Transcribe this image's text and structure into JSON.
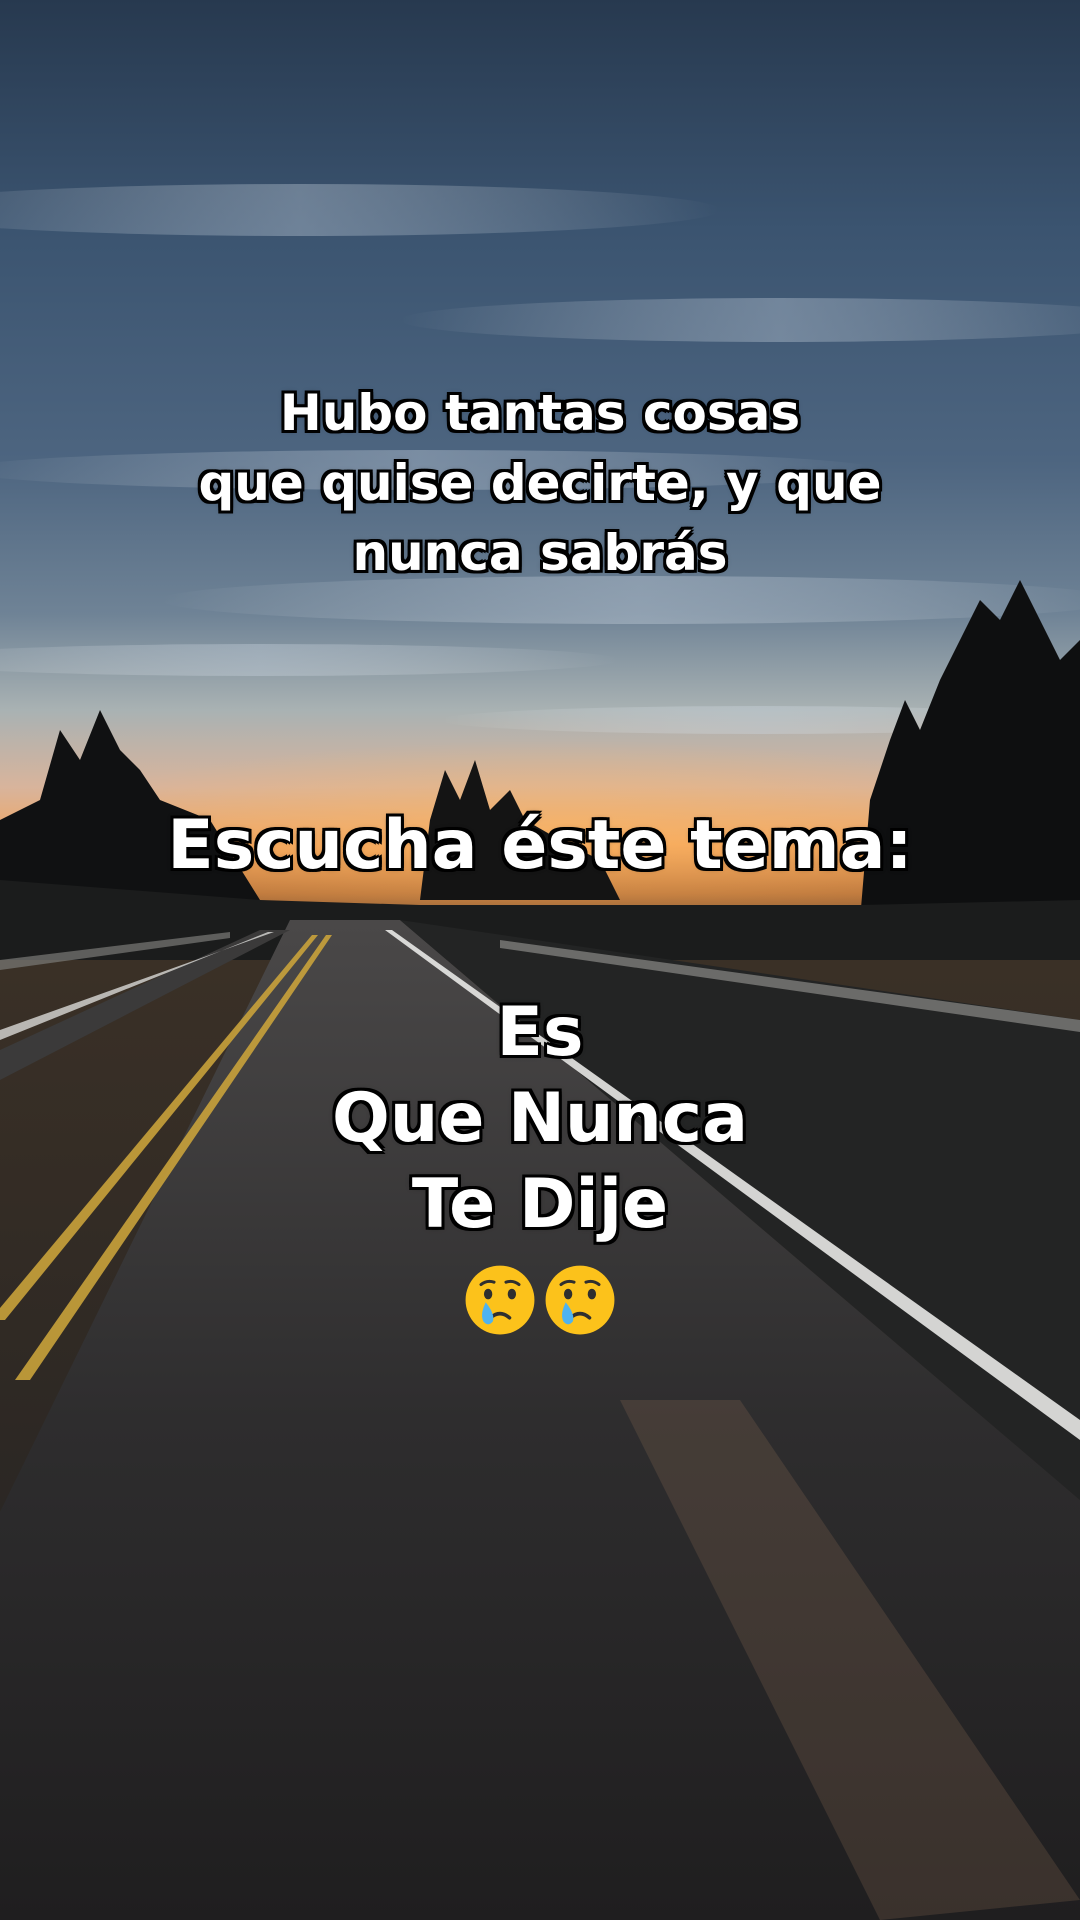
{
  "overlay": {
    "top_lines": [
      "Hubo tantas cosas",
      "que quise decirte, y que",
      "nunca sabrás"
    ],
    "middle_line": "Escucha éste tema:",
    "song_lines": [
      "Es",
      "Que Nunca",
      "Te Dije"
    ],
    "emojis": [
      "crying-face-emoji",
      "crying-face-emoji"
    ]
  },
  "colors": {
    "text": "#ffffff",
    "outline": "#000000",
    "sky_top": "#2f4662",
    "sunset": "#f0a85a",
    "road": "#2a2a2c"
  }
}
